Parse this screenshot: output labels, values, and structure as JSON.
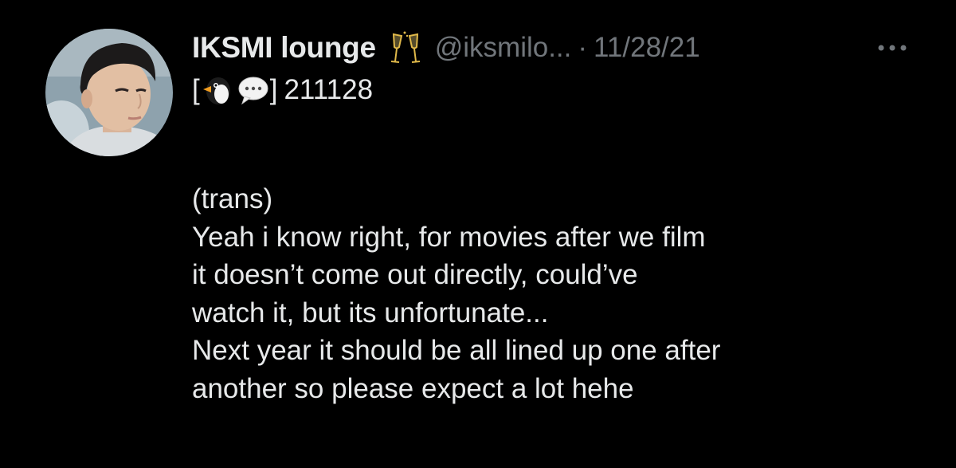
{
  "tweet": {
    "display_name": "IKSMI lounge",
    "name_emoji": "clinking-glasses",
    "handle": "@iksmilo...",
    "separator": "·",
    "date": "11/28/21",
    "first_line": {
      "open_bracket": "[",
      "emoji_1": "penguin",
      "emoji_2": "speech-balloon",
      "close_bracket": "]",
      "code": "211128"
    },
    "body_lines": [
      "(trans)",
      "Yeah i know right, for movies after we film",
      "it doesn’t come out directly, could’ve",
      "watch it, but its unfortunate...",
      "Next year it should be all lined up one after",
      "another so please expect a lot hehe"
    ]
  },
  "colors": {
    "background": "#000000",
    "primary_text": "#e7e9ea",
    "secondary_text": "#71767b"
  }
}
